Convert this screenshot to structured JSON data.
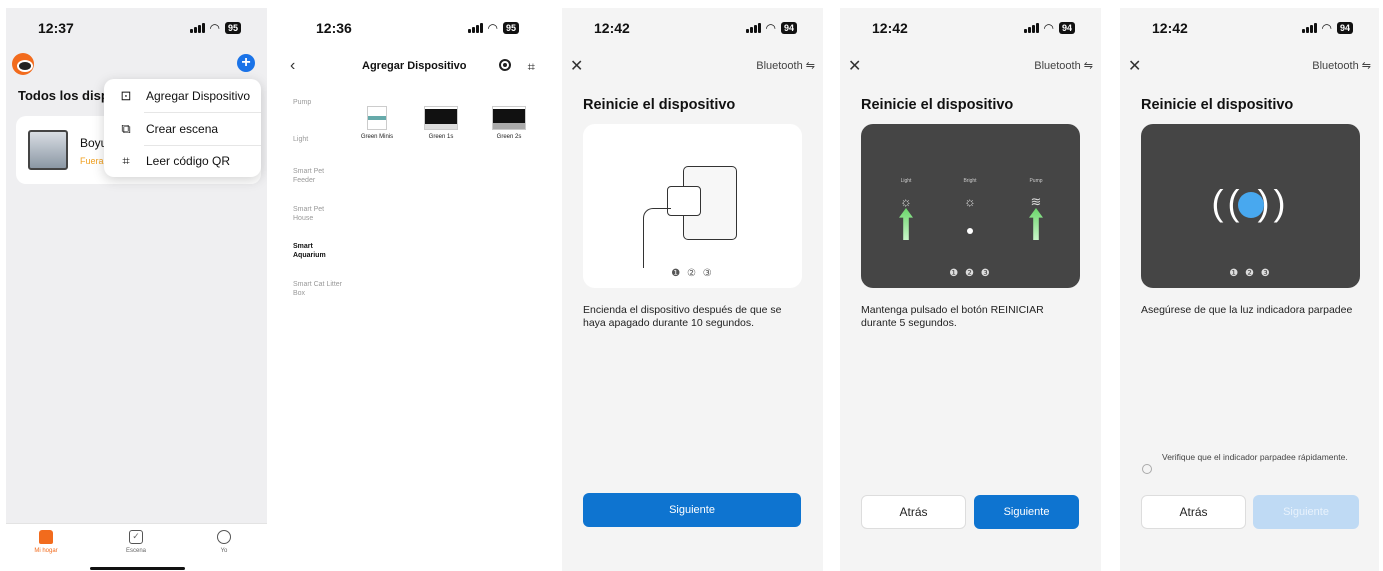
{
  "phone1": {
    "time": "12:37",
    "battery": "95",
    "home_title": "Todos los dispos",
    "device": {
      "name": "Boyu A",
      "status": "Fuera de"
    },
    "menu": [
      {
        "icon": "add-device-icon",
        "label": "Agregar Dispositivo"
      },
      {
        "icon": "create-scene-icon",
        "label": "Crear escena"
      },
      {
        "icon": "qr-scan-icon",
        "label": "Leer código QR"
      }
    ],
    "tabs": [
      {
        "label": "Mi hogar",
        "active": true
      },
      {
        "label": "Escena",
        "active": false
      },
      {
        "label": "Yo",
        "active": false
      }
    ]
  },
  "phone2": {
    "time": "12:36",
    "battery": "95",
    "title": "Agregar Dispositivo",
    "categories": [
      "Pump",
      "Light",
      "Smart Pet Feeder",
      "Smart Pet House",
      "Smart Aquarium",
      "Smart Cat Litter Box"
    ],
    "active_category": "Smart Aquarium",
    "products": [
      "Green Minis",
      "Green 1s",
      "Green 2s"
    ]
  },
  "phone3": {
    "time": "12:42",
    "battery": "94",
    "bluetooth": "Bluetooth ⇋",
    "title": "Reinicie el dispositivo",
    "steps": "❶ ② ③",
    "instruction": "Encienda el dispositivo después de que se haya apagado durante 10 segundos.",
    "next": "Siguiente"
  },
  "phone4": {
    "time": "12:42",
    "battery": "94",
    "bluetooth": "Bluetooth ⇋",
    "title": "Reinicie el dispositivo",
    "labels": [
      "Light",
      "Bright",
      "Pump"
    ],
    "steps": "❶ ❷ ❸",
    "instruction": "Mantenga pulsado el botón REINICIAR durante 5 segundos.",
    "back": "Atrás",
    "next": "Siguiente"
  },
  "phone5": {
    "time": "12:42",
    "battery": "94",
    "bluetooth": "Bluetooth ⇋",
    "title": "Reinicie el dispositivo",
    "waves": "((   ))",
    "steps": "❶ ❷ ❸",
    "instruction": "Asegúrese de que la luz indicadora parpadee",
    "checkbox": "Verifique que el indicador parpadee rápidamente.",
    "back": "Atrás",
    "next": "Siguiente"
  },
  "colors": {
    "accent": "#0e74d0",
    "home": "#f26b1d",
    "warning": "#f0a020",
    "led": "#48a8ef"
  }
}
